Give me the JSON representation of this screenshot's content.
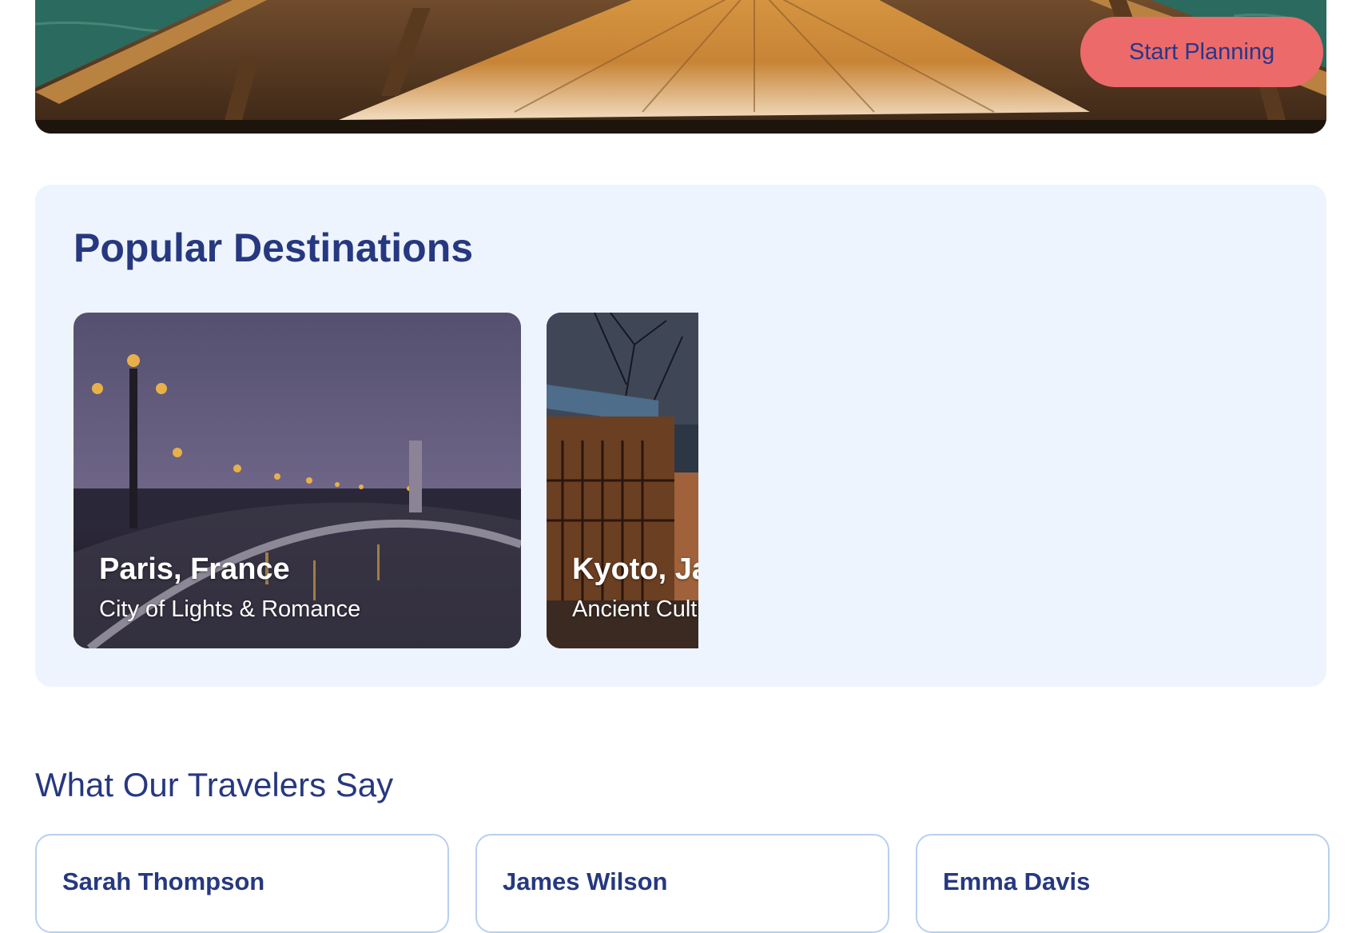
{
  "hero": {
    "cta_label": "Start Planning",
    "image": "wooden-boat-bow-on-water"
  },
  "destinations": {
    "title": "Popular Destinations",
    "items": [
      {
        "name": "Paris, France",
        "tagline": "City of Lights & Romance",
        "image": "paris-bridge-at-dusk"
      },
      {
        "name": "Kyoto, Japan",
        "tagline": "Ancient Culture",
        "image": "kyoto-wooden-houses"
      }
    ]
  },
  "testimonials": {
    "title": "What Our Travelers Say",
    "items": [
      {
        "name": "Sarah Thompson"
      },
      {
        "name": "James Wilson"
      },
      {
        "name": "Emma Davis"
      }
    ]
  },
  "colors": {
    "accent": "#ec6a6a",
    "heading": "#26387f",
    "panel_bg": "#eef4fd",
    "card_border": "#b8d0f0"
  }
}
